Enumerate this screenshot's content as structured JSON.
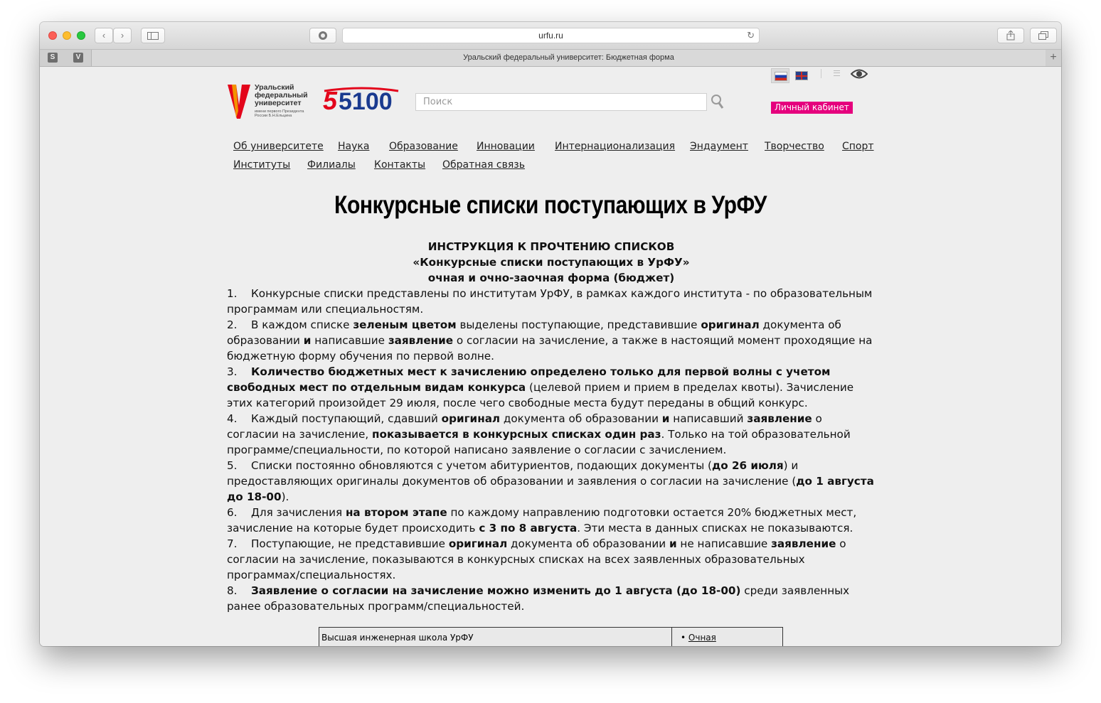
{
  "browser": {
    "url": "urfu.ru",
    "tab_title": "Уральский федеральный университет: Бюджетная форма",
    "favicons": [
      "S",
      "V"
    ]
  },
  "header": {
    "logo_lines": [
      "Уральский",
      "федеральный",
      "университет"
    ],
    "logo_small_lines": [
      "имени первого Президента",
      "России Б.Н.Ельцина"
    ],
    "badge": "5100",
    "search_placeholder": "Поиск",
    "cabinet_label": "Личный кабинет"
  },
  "nav": {
    "row1": [
      "Об университете",
      "Наука",
      "Образование",
      "Инновации",
      "Интернационализация",
      "Эндаумент",
      "Творчество",
      "Спорт"
    ],
    "row2": [
      "Институты",
      "Филиалы",
      "Контакты",
      "Обратная связь"
    ]
  },
  "page": {
    "title": "Конкурсные списки поступающих в УрФУ",
    "instr_heading": [
      "ИНСТРУКЦИЯ К ПРОЧТЕНИЮ СПИСКОВ",
      "«Конкурсные списки поступающих в УрФУ»",
      "очная и очно-заочная форма (бюджет)"
    ],
    "items": [
      [
        {
          "t": "Конкурсные списки представлены по институтам УрФУ, в рамках каждого института - по образовательным программам или специальностям."
        }
      ],
      [
        {
          "t": "В каждом списке "
        },
        {
          "t": "зеленым цветом",
          "b": true
        },
        {
          "t": " выделены поступающие, представившие "
        },
        {
          "t": "оригинал",
          "b": true
        },
        {
          "t": " документа об образовании "
        },
        {
          "t": "и",
          "b": true
        },
        {
          "t": " написавшие "
        },
        {
          "t": "заявление",
          "b": true
        },
        {
          "t": " о согласии на зачисление, а также в настоящий момент проходящие на бюджетную форму обучения по первой волне."
        }
      ],
      [
        {
          "t": "Количество бюджетных мест к зачислению определено только для первой волны с учетом свободных мест по отдельным видам конкурса",
          "b": true
        },
        {
          "t": " (целевой прием и прием в пределах квоты). Зачисление этих категорий произойдет 29 июля, после чего свободные места будут переданы в общий конкурс."
        }
      ],
      [
        {
          "t": "Каждый поступающий, сдавший "
        },
        {
          "t": "оригинал",
          "b": true
        },
        {
          "t": " документа об образовании "
        },
        {
          "t": "и",
          "b": true
        },
        {
          "t": " написавший "
        },
        {
          "t": "заявление",
          "b": true
        },
        {
          "t": " о согласии на зачисление, "
        },
        {
          "t": "показывается в  конкурсных списках один раз",
          "b": true
        },
        {
          "t": ". Только на той образовательной программе/специальности, по которой написано заявление о согласии с зачислением."
        }
      ],
      [
        {
          "t": "Списки постоянно обновляются с учетом абитуриентов, подающих документы ("
        },
        {
          "t": "до 26 июля",
          "b": true
        },
        {
          "t": ") и  предоставляющих оригиналы документов об образовании и заявления о согласии на зачисление ("
        },
        {
          "t": "до 1 августа до 18-00",
          "b": true
        },
        {
          "t": ")."
        }
      ],
      [
        {
          "t": "Для зачисления "
        },
        {
          "t": "на втором этапе",
          "b": true
        },
        {
          "t": " по каждому направлению подготовки остается 20% бюджетных мест, зачисление на которые будет происходить "
        },
        {
          "t": "с 3 по 8 августа",
          "b": true
        },
        {
          "t": ". Эти места в данных списках не показываются."
        }
      ],
      [
        {
          "t": "Поступающие, не представившие "
        },
        {
          "t": "оригинал",
          "b": true
        },
        {
          "t": " документа об образовании "
        },
        {
          "t": "и",
          "b": true
        },
        {
          "t": " не написавшие "
        },
        {
          "t": "заявление",
          "b": true
        },
        {
          "t": " о согласии на зачисление, показываются в конкурсных списках на всех заявленных образовательных программах/специальностях."
        }
      ],
      [
        {
          "t": "Заявление о согласии на зачисление можно изменить до 1 августа (до 18-00)",
          "b": true
        },
        {
          "t": " среди заявленных ранее образовательных программ/специальностей."
        }
      ]
    ],
    "table": {
      "school": "Высшая инженерная школа УрФУ",
      "link": "Очная"
    }
  }
}
